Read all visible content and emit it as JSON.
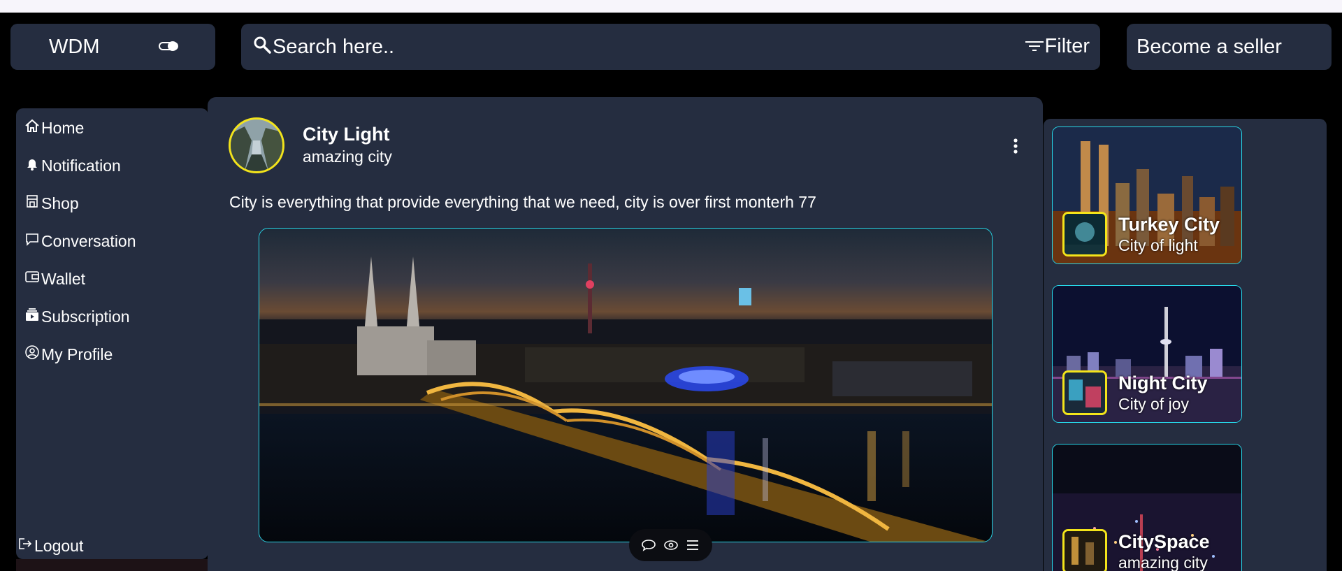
{
  "brand": {
    "name": "WDM"
  },
  "search": {
    "placeholder": "Search here..",
    "filter_label": "Filter"
  },
  "seller": {
    "label": "Become a seller"
  },
  "sidebar": {
    "items": [
      {
        "label": "Home",
        "icon": "home-icon"
      },
      {
        "label": "Notification",
        "icon": "bell-icon"
      },
      {
        "label": "Shop",
        "icon": "shop-icon"
      },
      {
        "label": "Conversation",
        "icon": "chat-icon"
      },
      {
        "label": "Wallet",
        "icon": "wallet-icon"
      },
      {
        "label": "Subscription",
        "icon": "subscription-icon"
      },
      {
        "label": "My Profile",
        "icon": "profile-icon"
      }
    ],
    "logout": {
      "label": "Logout",
      "icon": "logout-icon"
    }
  },
  "post": {
    "title": "City Light",
    "subtitle": "amazing city",
    "text": "City is everything that provide everything that we need, city is over first monterh 77",
    "actions": [
      "comment-icon",
      "view-icon",
      "menu-icon"
    ]
  },
  "cards": [
    {
      "title": "Turkey City",
      "subtitle": "City of light"
    },
    {
      "title": "Night City",
      "subtitle": "City of joy"
    },
    {
      "title": "CitySpace",
      "subtitle": "amazing city"
    }
  ],
  "colors": {
    "background": "#000000",
    "panel": "#252d40",
    "accent_border": "#27d7e8",
    "avatar_ring": "#f3e41a"
  }
}
